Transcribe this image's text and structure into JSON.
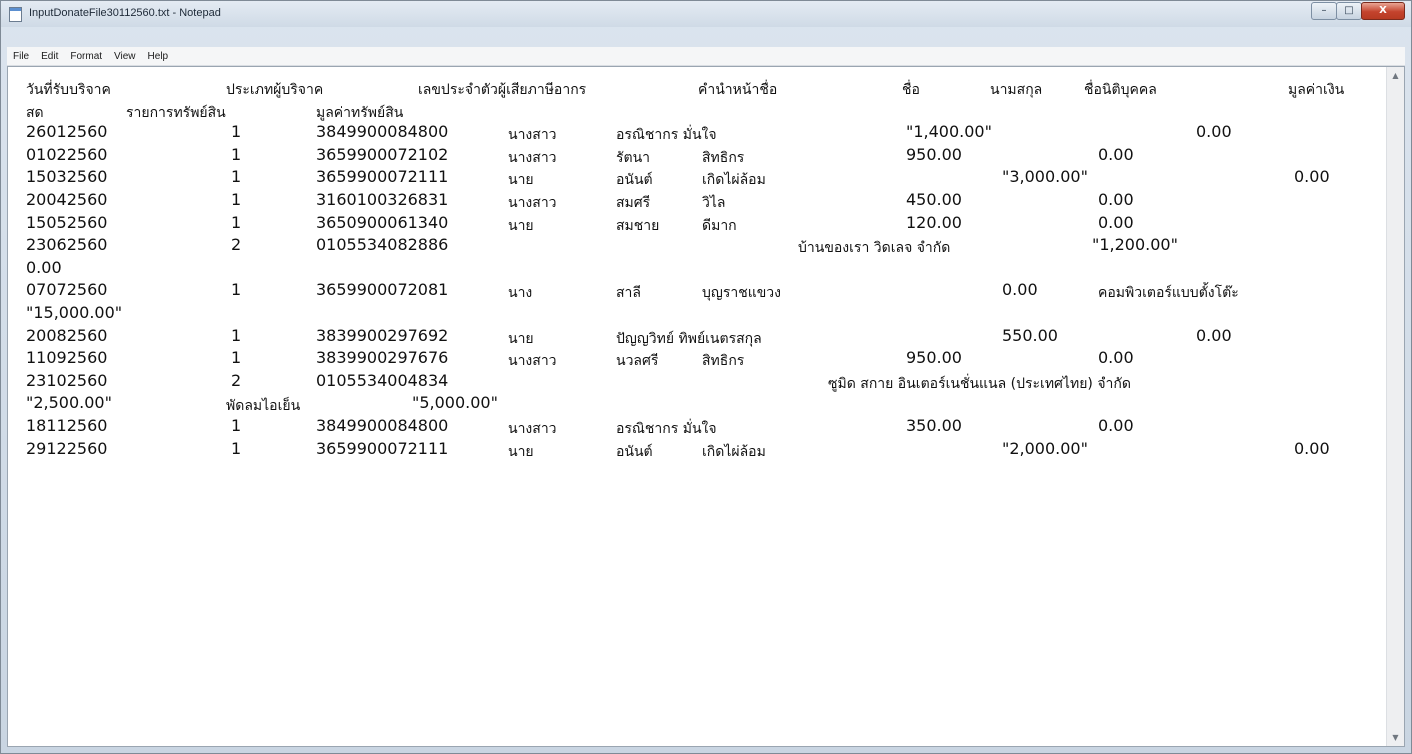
{
  "window": {
    "title": "InputDonateFile30112560.txt - Notepad",
    "controls": {
      "minimize": "–",
      "maximize": "□",
      "close": "X"
    }
  },
  "menu": [
    "File",
    "Edit",
    "Format",
    "View",
    "Help"
  ],
  "lines": [
    [
      "วันที่รับบริจาค",
      "ประเภทผู้บริจาค",
      "เลขประจำตัวผู้เสียภาษีอากร",
      "คำนำหน้าชื่อ",
      "ชื่อ",
      "นามสกุล",
      "ชื่อนิติบุคคล",
      "มูลค่าเงิน"
    ],
    [
      "สด",
      "รายการทรัพย์สิน",
      "มูลค่าทรัพย์สิน"
    ],
    [
      "26012560",
      "1",
      "3849900084800",
      "นางสาว",
      "อรณิชากร มั่นใจ",
      "\"1,400.00\"",
      "0.00"
    ],
    [
      "01022560",
      "1",
      "3659900072102",
      "นางสาว",
      "รัตนา",
      "สิทธิกร",
      "950.00",
      "0.00"
    ],
    [
      "15032560",
      "1",
      "3659900072111",
      "นาย",
      "อนันต์",
      "เกิดไผ่ล้อม",
      "\"3,000.00\"",
      "0.00"
    ],
    [
      "20042560",
      "1",
      "3160100326831",
      "นางสาว",
      "สมศรี",
      "วิไล",
      "450.00",
      "0.00"
    ],
    [
      "15052560",
      "1",
      "3650900061340",
      "นาย",
      "สมชาย",
      "ดีมาก",
      "120.00",
      "0.00"
    ],
    [
      "23062560",
      "2",
      "0105534082886",
      "บ้านของเรา วิดเลจ จำกัด",
      "\"1,200.00\""
    ],
    [
      "0.00"
    ],
    [
      "07072560",
      "1",
      "3659900072081",
      "นาง",
      "สาลี",
      "บุญราชแขวง",
      "0.00",
      "คอมพิวเตอร์แบบตั้งโต๊ะ"
    ],
    [
      "\"15,000.00\""
    ],
    [
      "20082560",
      "1",
      "3839900297692",
      "นาย",
      "ปัญญวิทย์ ทิพย์เนตรสกุล",
      "550.00",
      "0.00"
    ],
    [
      "11092560",
      "1",
      "3839900297676",
      "นางสาว",
      "นวลศรี",
      "สิทธิกร",
      "950.00",
      "0.00"
    ],
    [
      "23102560",
      "2",
      "0105534004834",
      "ซูมิด สกาย อินเตอร์เนชั่นแนล (ประเทศไทย) จำกัด"
    ],
    [
      "\"2,500.00\"",
      "พัดลมไอเย็น",
      "\"5,000.00\""
    ],
    [
      "18112560",
      "1",
      "3849900084800",
      "นางสาว",
      "อรณิชากร มั่นใจ",
      "350.00",
      "0.00"
    ],
    [
      "29122560",
      "1",
      "3659900072111",
      "นาย",
      "อนันต์",
      "เกิดไผ่ล้อม",
      "\"2,000.00\"",
      "0.00"
    ]
  ]
}
